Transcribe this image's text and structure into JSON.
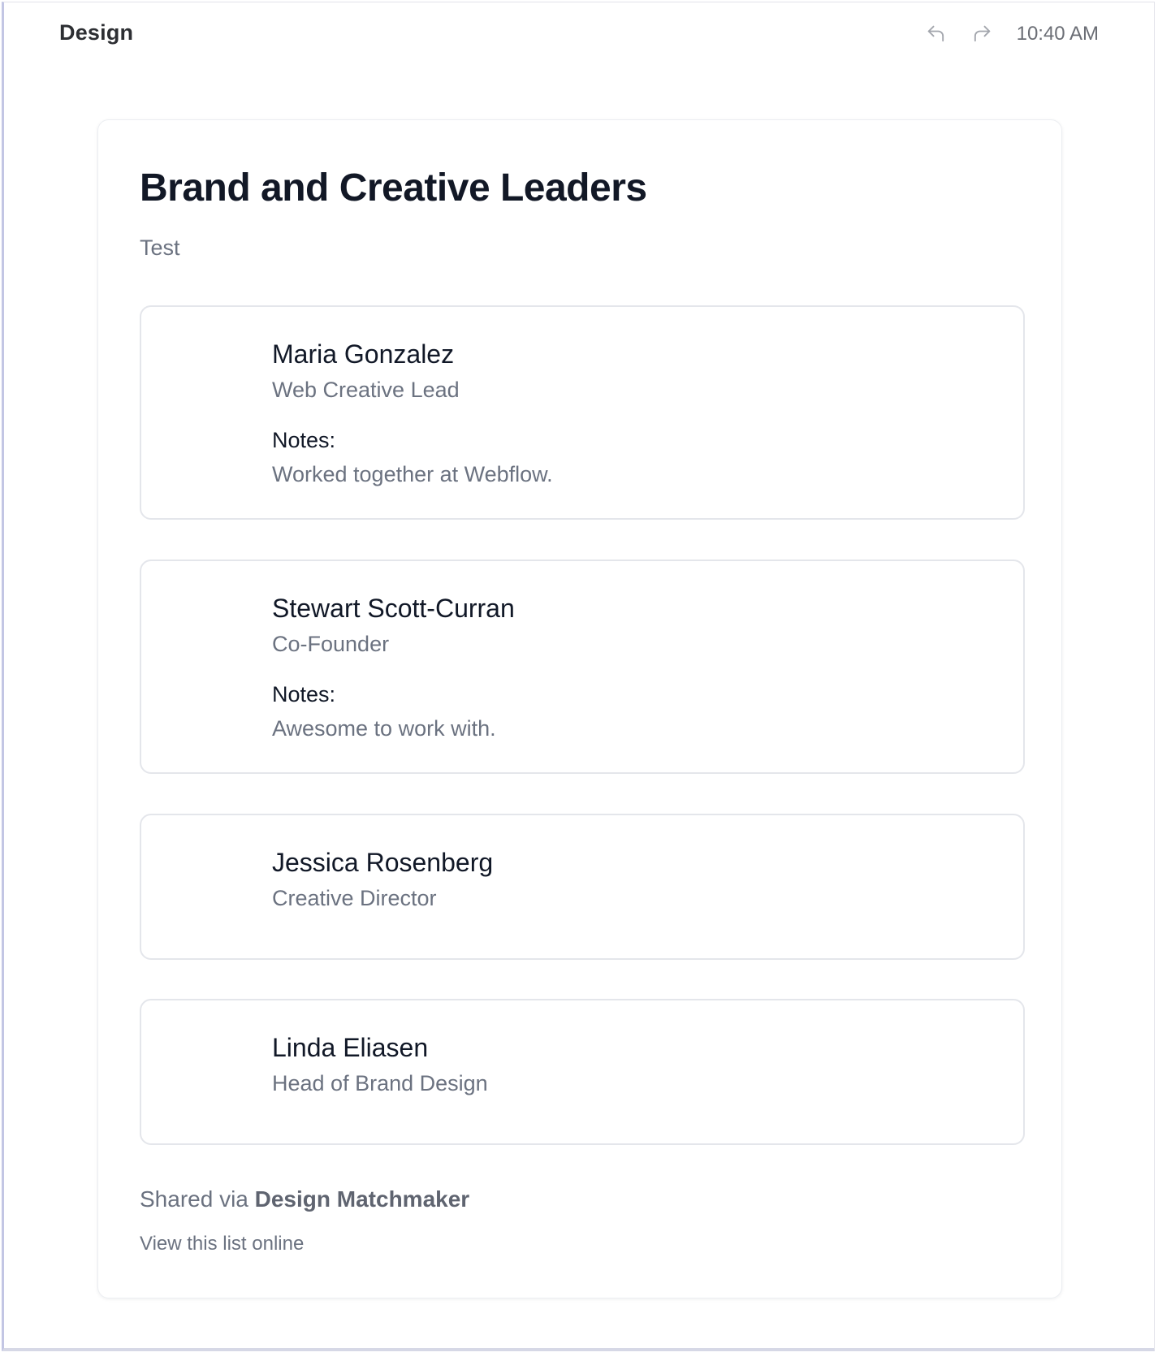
{
  "header": {
    "app_title": "Design",
    "time": "10:40 AM",
    "undo_icon": "undo-icon",
    "redo_icon": "redo-icon"
  },
  "list": {
    "title": "Brand and Creative Leaders",
    "description": "Test",
    "notes_label": "Notes:",
    "entries": [
      {
        "name": "Maria Gonzalez",
        "role": "Web Creative Lead",
        "notes": "Worked together at Webflow."
      },
      {
        "name": "Stewart Scott-Curran",
        "role": "Co-Founder",
        "notes": "Awesome to work with."
      },
      {
        "name": "Jessica Rosenberg",
        "role": "Creative Director"
      },
      {
        "name": "Linda Eliasen",
        "role": "Head of Brand Design"
      }
    ]
  },
  "footer": {
    "shared_prefix": "Shared via ",
    "shared_brand": "Design Matchmaker",
    "view_link": "View this list online"
  },
  "colors": {
    "title": "#121826",
    "muted_text": "#6b7280",
    "border": "#e4e6eb",
    "window_accent": "#c3c6e4"
  }
}
